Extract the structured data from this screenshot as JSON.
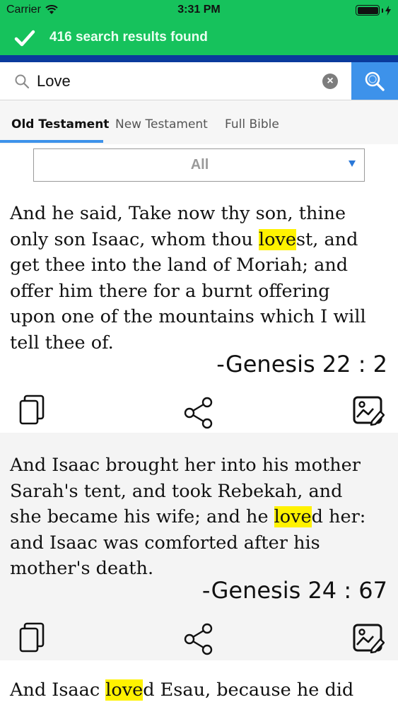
{
  "status": {
    "carrier": "Carrier",
    "time": "3:31 PM"
  },
  "toast": {
    "message": "416 search results found"
  },
  "search": {
    "query": "Love",
    "placeholder": ""
  },
  "tabs": [
    {
      "label": "Old Testament",
      "active": true
    },
    {
      "label": "New Testament",
      "active": false
    },
    {
      "label": "Full Bible",
      "active": false
    }
  ],
  "filter": {
    "selected": "All"
  },
  "colors": {
    "accent_green": "#16c25c",
    "accent_blue": "#3d92ea",
    "highlight": "#fff200",
    "dark_blue": "#0a3a9c"
  },
  "icons": {
    "copy": "copy-icon",
    "share": "share-icon",
    "image": "image-edit-icon",
    "search": "search-icon",
    "clear": "clear-icon",
    "check": "check-icon",
    "wifi": "wifi-icon",
    "battery": "battery-icon"
  },
  "verses": [
    {
      "lines": [
        {
          "pre": "And he said, Take now thy son, thine",
          "hl": "",
          "post": ""
        },
        {
          "pre": "only son Isaac, whom thou ",
          "hl": "love",
          "post": "st, and"
        },
        {
          "pre": "get thee into the land of Moriah; and",
          "hl": "",
          "post": ""
        },
        {
          "pre": "offer him there for a burnt offering",
          "hl": "",
          "post": ""
        },
        {
          "pre": "upon one of the mountains which I will",
          "hl": "",
          "post": ""
        },
        {
          "pre": "tell thee of.",
          "hl": "",
          "post": ""
        }
      ],
      "reference": "-Genesis 22 : 2"
    },
    {
      "lines": [
        {
          "pre": "And Isaac brought her into his mother",
          "hl": "",
          "post": ""
        },
        {
          "pre": "Sarah's tent, and took Rebekah, and",
          "hl": "",
          "post": ""
        },
        {
          "pre": "she became his wife; and he ",
          "hl": "love",
          "post": "d her:"
        },
        {
          "pre": "and Isaac was comforted after his",
          "hl": "",
          "post": ""
        },
        {
          "pre": "mother's death.",
          "hl": "",
          "post": ""
        }
      ],
      "reference": "-Genesis 24 : 67"
    },
    {
      "lines": [
        {
          "pre": "And Isaac ",
          "hl": "love",
          "post": "d Esau, because he did"
        }
      ],
      "reference": ""
    }
  ]
}
